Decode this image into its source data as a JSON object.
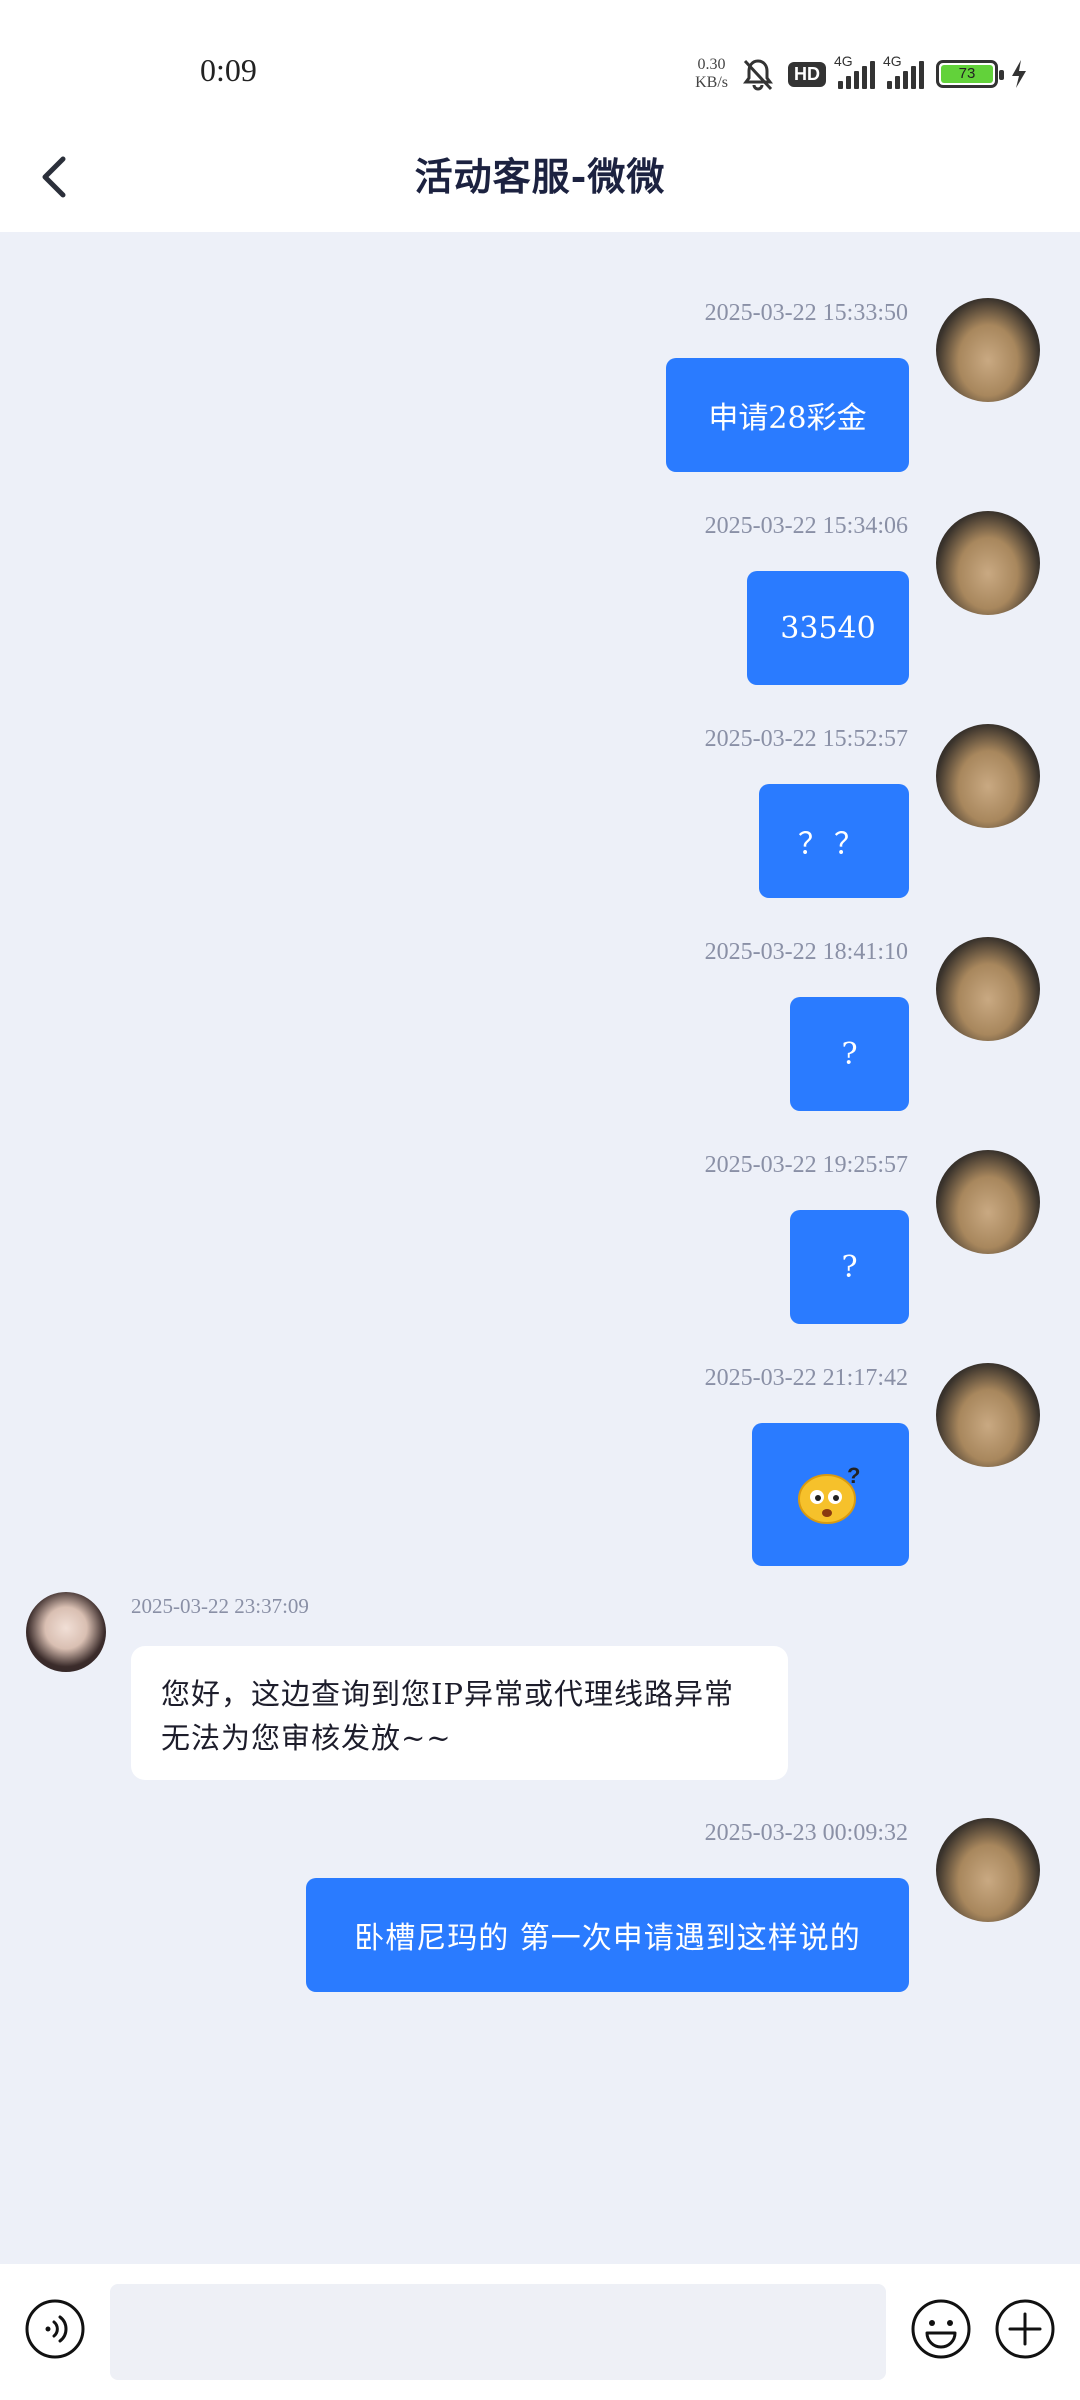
{
  "status_bar": {
    "time": "0:09",
    "net_speed_value": "0.30",
    "net_speed_unit": "KB/s",
    "hd_label": "HD",
    "signal_1_label": "4G",
    "signal_2_label": "4G",
    "battery_level": "73"
  },
  "header": {
    "title": "活动客服-微微"
  },
  "messages": [
    {
      "time": "2025-03-22  15:33:50",
      "text": "申请28彩金",
      "direction": "out"
    },
    {
      "time": "2025-03-22  15:34:06",
      "text": "33540",
      "direction": "out"
    },
    {
      "time": "2025-03-22  15:52:57",
      "text": "？？",
      "direction": "out"
    },
    {
      "time": "2025-03-22  18:41:10",
      "text": "?",
      "direction": "out"
    },
    {
      "time": "2025-03-22  19:25:57",
      "text": "?",
      "direction": "out"
    },
    {
      "time": "2025-03-22  21:17:42",
      "text": "",
      "direction": "out",
      "sticker": "confused-face-sticker"
    },
    {
      "time": "2025-03-22  23:37:09",
      "text": "您好，这边查询到您IP异常或代理线路异常无法为您审核发放~~",
      "direction": "in"
    },
    {
      "time": "2025-03-23  00:09:32",
      "text": "卧槽尼玛的 第一次申请遇到这样说的",
      "direction": "out"
    }
  ],
  "input": {
    "placeholder": ""
  },
  "colors": {
    "accent": "#2a7bff",
    "chat_background": "#edf0f8",
    "incoming_bubble": "#ffffff"
  },
  "icons": {
    "back": "chevron-left-icon",
    "voice": "voice-icon",
    "emoji": "emoji-icon",
    "plus": "plus-icon"
  }
}
